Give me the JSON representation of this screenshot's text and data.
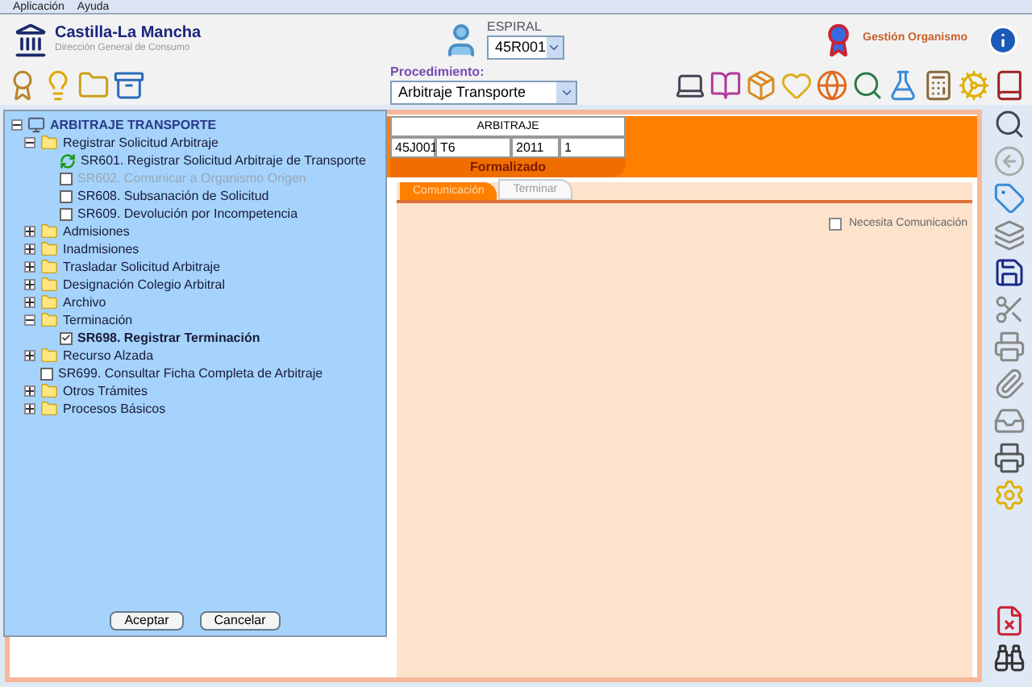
{
  "menu_bar": [
    "Aplicación",
    "Ayuda"
  ],
  "header": {
    "org_name": "Castilla-La Mancha",
    "org_subtitle": "Dirección General de Consumo",
    "user_label": "ESPIRAL",
    "user_value": "45R001",
    "section": "Gestión Organismo"
  },
  "procedure": {
    "label": "Procedimiento:",
    "value": "Arbitraje Transporte"
  },
  "record": {
    "title": "ARBITRAJE",
    "cells": [
      "45J001",
      "T6",
      "2011",
      "1"
    ],
    "status": "Formalizado"
  },
  "tabs": [
    {
      "label": "Comunicación",
      "selected": true
    },
    {
      "label": "Terminar",
      "selected": false
    }
  ],
  "options": [
    {
      "label": "Necesita Comunicación",
      "checked": false
    }
  ],
  "tree": {
    "label": "ARBITRAJE TRANSPORTE",
    "expanded": true,
    "children": [
      {
        "kind": "folder",
        "label": "Registrar Solicitud Arbitraje",
        "expanded": true,
        "children": [
          {
            "kind": "current",
            "label": "SR601. Registrar Solicitud Arbitraje de Transporte"
          },
          {
            "kind": "task",
            "label": "SR602. Comunicar a Organismo Origen",
            "checked": false,
            "disabled": true
          },
          {
            "kind": "task",
            "label": "SR608. Subsanación de Solicitud",
            "checked": false,
            "disabled": false
          },
          {
            "kind": "task",
            "label": "SR609. Devolución por Incompetencia",
            "checked": false,
            "disabled": false
          }
        ]
      },
      {
        "kind": "folder",
        "label": "Admisiones",
        "expanded": false
      },
      {
        "kind": "folder",
        "label": "Inadmisiones",
        "expanded": false
      },
      {
        "kind": "folder",
        "label": "Trasladar Solicitud Arbitraje",
        "expanded": false
      },
      {
        "kind": "folder",
        "label": "Designación Colegio Arbitral",
        "expanded": false
      },
      {
        "kind": "folder",
        "label": "Archivo",
        "expanded": false
      },
      {
        "kind": "folder",
        "label": "Terminación",
        "expanded": true,
        "children": [
          {
            "kind": "task",
            "label": "SR698. Registrar Terminación",
            "checked": true,
            "disabled": false
          }
        ]
      },
      {
        "kind": "folder",
        "label": "Recurso Alzada",
        "expanded": false
      },
      {
        "kind": "task",
        "label": "SR699. Consultar Ficha Completa de Arbitraje",
        "checked": false,
        "disabled": false
      },
      {
        "kind": "folder",
        "label": "Otros Trámites",
        "expanded": false
      },
      {
        "kind": "folder",
        "label": "Procesos Básicos",
        "expanded": false
      }
    ]
  },
  "dialog_buttons": [
    "Aceptar",
    "Cancelar"
  ]
}
